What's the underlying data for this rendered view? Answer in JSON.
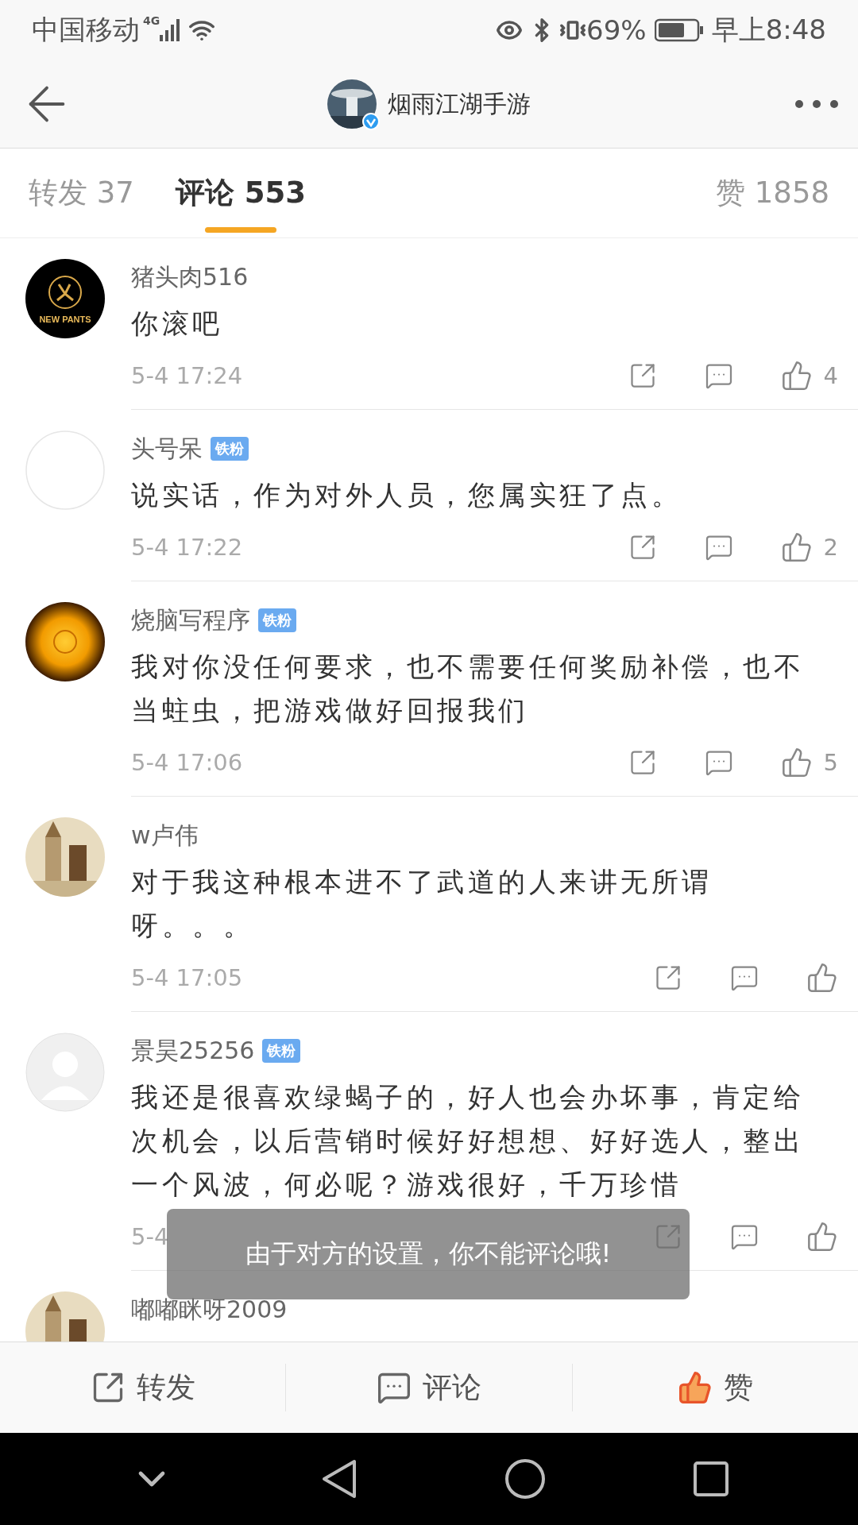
{
  "status_bar": {
    "carrier": "中国移动",
    "network": "4G",
    "battery": "69%",
    "time": "早上8:48"
  },
  "header": {
    "title": "烟雨江湖手游",
    "verified": true
  },
  "tabs": [
    {
      "label": "转发 37",
      "selected": false
    },
    {
      "label": "评论 553",
      "selected": true
    },
    {
      "label": "赞 1858",
      "selected": false
    }
  ],
  "comments": [
    {
      "avatar": {
        "kind": "logo",
        "text": "NEW PANTS"
      },
      "name": "猪头肉516",
      "text": "你滚吧",
      "time": "5-4 17:24",
      "likes": "4"
    },
    {
      "avatar": {
        "kind": "blank"
      },
      "name": "头号呆",
      "badge": "铁粉",
      "text": "说实话，作为对外人员，您属实狂了点。",
      "time": "5-4 17:22",
      "likes": "2"
    },
    {
      "avatar": {
        "kind": "orb"
      },
      "name": "烧脑写程序",
      "badge": "铁粉",
      "text": "我对你没任何要求，也不需要任何奖励补偿，也不当蛀虫，把游戏做好回报我们",
      "time": "5-4 17:06",
      "likes": "5"
    },
    {
      "name": "w卢伟",
      "text": "对于我这种根本进不了武道的人来讲无所谓呀。。。",
      "time": "5-4 17:05"
    },
    {
      "avatar": {
        "kind": "silhouette"
      },
      "name": "景昊25256",
      "badge": "铁粉",
      "text": "我还是很喜欢绿蝎子的，好人也会办坏事，肯定给次机会，以后营销时候好好想想、好好选人，整出一个风波，何必呢？游戏很好，千万珍惜",
      "time": "5-4"
    },
    {
      "name": "嘟嘟眯呀2009"
    }
  ],
  "toast": "由于对方的设置，你不能评论哦!",
  "bottom_bar": [
    {
      "kind": "repost",
      "label": "转发"
    },
    {
      "kind": "comment",
      "label": "评论"
    },
    {
      "kind": "like",
      "label": "赞",
      "liked": true
    }
  ]
}
